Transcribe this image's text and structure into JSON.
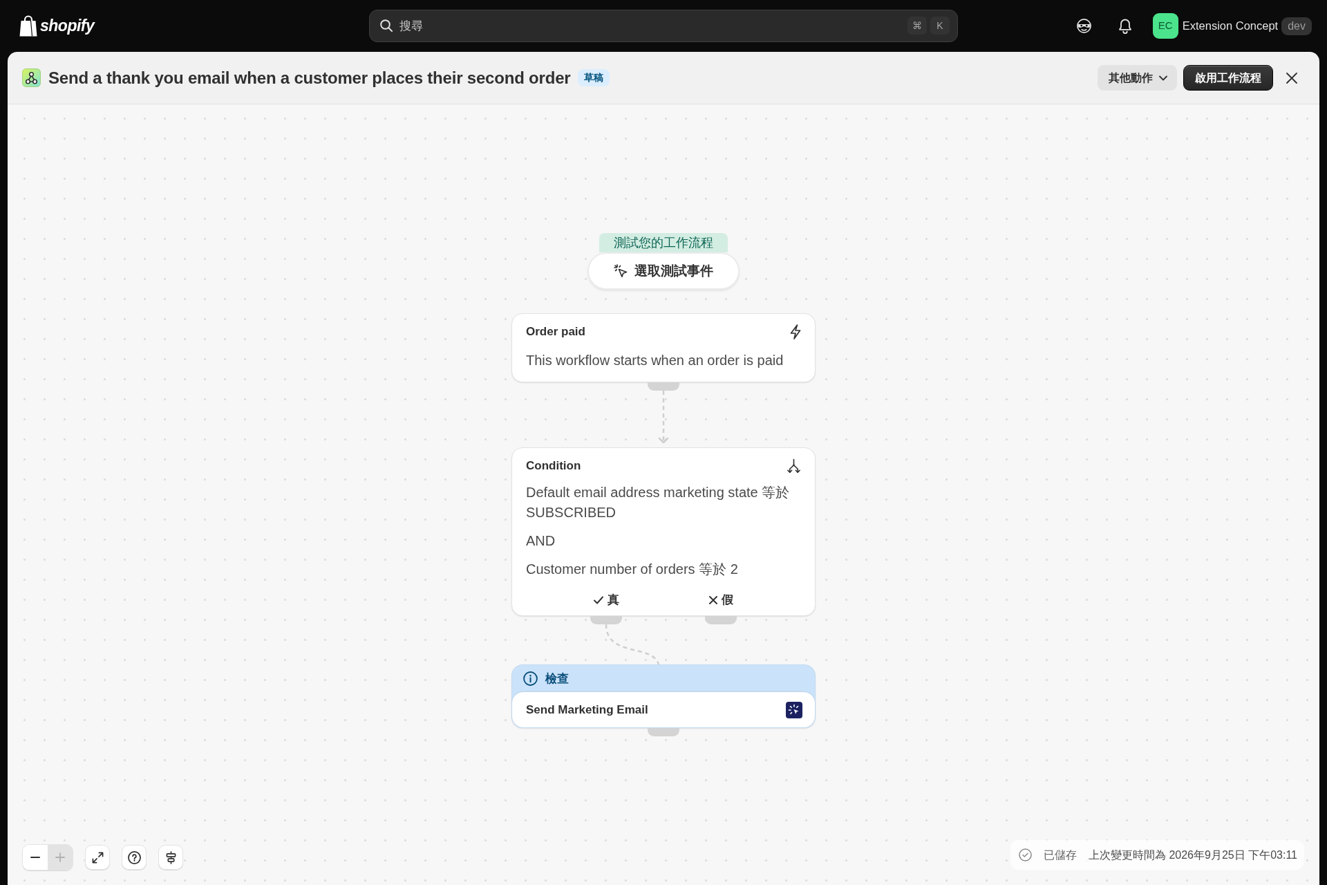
{
  "top_bar": {
    "brand": "shopify",
    "search": {
      "placeholder": "搜尋",
      "shortcut": [
        "⌘",
        "K"
      ]
    },
    "account": {
      "initials": "EC",
      "name": "Extension Concept",
      "badge": "dev"
    }
  },
  "header": {
    "title": "Send a thank you email when a customer places their second order",
    "status": "草稿",
    "buttons": [
      {
        "kind": "menu",
        "label": "其他動作"
      },
      {
        "kind": "primary",
        "label": "啟用工作流程"
      }
    ]
  },
  "test_panel": {
    "tab": "測試您的工作流程",
    "button": "選取測試事件"
  },
  "nodes": [
    {
      "kind": "trigger",
      "title": "Order paid",
      "lines": [
        "This workflow starts when an order is paid"
      ]
    },
    {
      "kind": "condition",
      "title": "Condition",
      "lines": [
        "Default email address marketing state 等於 SUBSCRIBED",
        "AND",
        "Customer number of orders 等於 2"
      ],
      "branches": [
        {
          "kind": "true",
          "label": "真",
          "connected": true
        },
        {
          "kind": "false",
          "label": "假",
          "connected": false
        }
      ]
    },
    {
      "kind": "action",
      "notice": "檢查",
      "title": "Send Marketing Email"
    }
  ],
  "zoom": [
    {
      "kind": "out",
      "disabled": false
    },
    {
      "kind": "in",
      "disabled": true
    }
  ],
  "tools": [
    {
      "kind": "fit"
    },
    {
      "kind": "help"
    },
    {
      "kind": "align"
    }
  ],
  "status_bar": {
    "saved": "已儲存",
    "last_changed": "上次變更時間為 2026年9月25日 下午03:11"
  }
}
